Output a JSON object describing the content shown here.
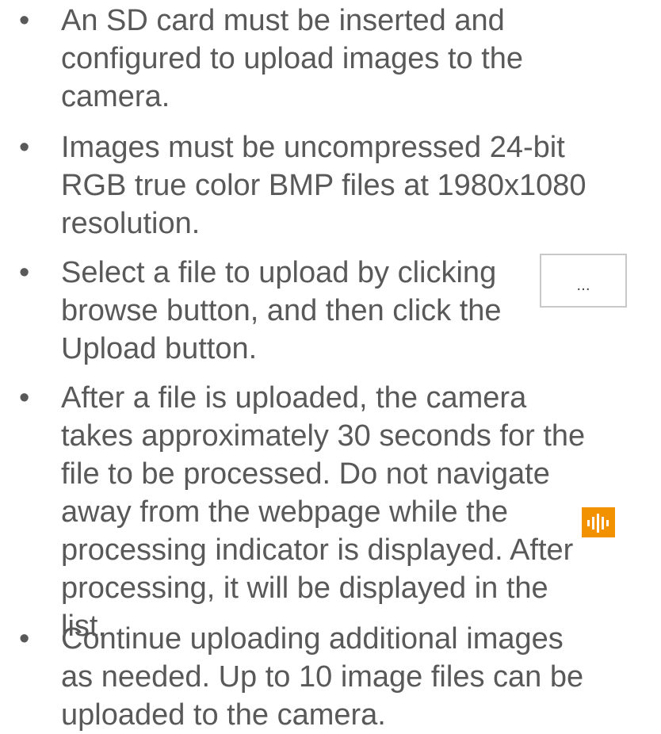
{
  "bullets": [
    {
      "marker": "•",
      "lines": [
        "An SD card must be inserted and",
        "configured to upload images to the",
        "camera."
      ]
    },
    {
      "marker": "•",
      "lines": [
        "Images must be uncompressed 24-bit",
        "RGB true color BMP files at 1980x1080",
        "resolution."
      ]
    },
    {
      "marker": "•",
      "lines": [
        "Select a file to upload by clicking",
        "browse button, and then click the",
        "Upload button."
      ]
    },
    {
      "marker": "•",
      "lines": [
        "After a file is uploaded, the camera",
        "takes approximately 30 seconds for the",
        "file to be processed.  Do not navigate",
        "away from the webpage while the",
        "processing indicator is displayed.  After",
        "processing, it will be displayed in the",
        "list."
      ]
    },
    {
      "marker": "•",
      "lines": [
        "Continue uploading additional images",
        "as needed.  Up to 10 image files can be",
        "uploaded to the camera."
      ]
    }
  ],
  "browse_button": {
    "label": "..."
  },
  "processing_indicator": {
    "icon": "processing-indicator-icon",
    "color": "#f39200"
  },
  "colors": {
    "text": "#595959",
    "accent": "#f39200"
  }
}
